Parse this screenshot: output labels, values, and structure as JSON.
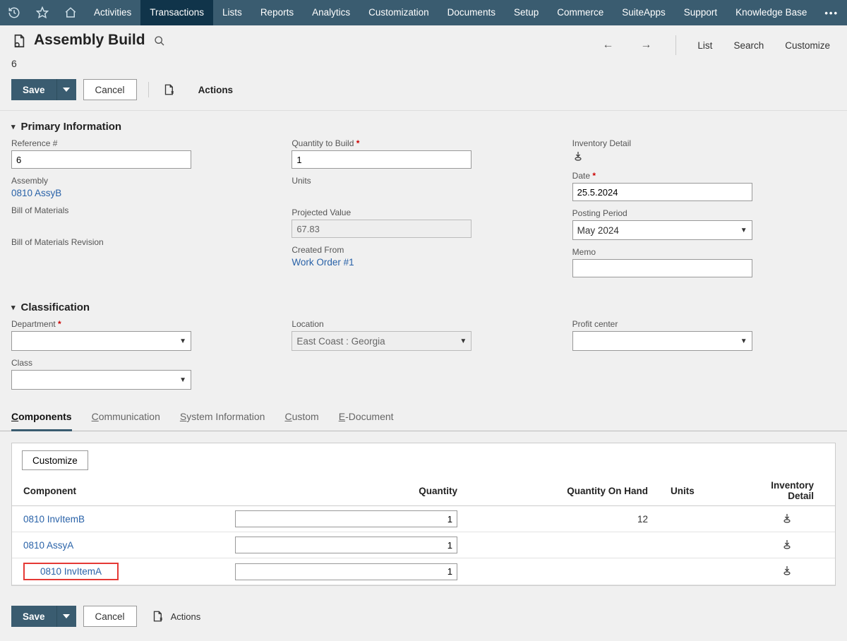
{
  "nav": {
    "items": [
      "Activities",
      "Transactions",
      "Lists",
      "Reports",
      "Analytics",
      "Customization",
      "Documents",
      "Setup",
      "Commerce",
      "SuiteApps",
      "Support",
      "Knowledge Base"
    ],
    "active_index": 1
  },
  "header": {
    "title": "Assembly Build",
    "record_sub": "6",
    "right_links": {
      "list": "List",
      "search": "Search",
      "customize": "Customize"
    }
  },
  "toolbar": {
    "save": "Save",
    "cancel": "Cancel",
    "actions": "Actions"
  },
  "sections": {
    "primary": "Primary Information",
    "classification": "Classification"
  },
  "form": {
    "reference": {
      "label": "Reference #",
      "value": "6"
    },
    "assembly": {
      "label": "Assembly",
      "value": "0810 AssyB"
    },
    "bom": {
      "label": "Bill of Materials"
    },
    "bom_rev": {
      "label": "Bill of Materials Revision"
    },
    "qty_build": {
      "label": "Quantity to Build",
      "value": "1"
    },
    "units": {
      "label": "Units"
    },
    "projected": {
      "label": "Projected Value",
      "value": "67.83"
    },
    "created_from": {
      "label": "Created From",
      "value": "Work Order #1"
    },
    "inv_detail": {
      "label": "Inventory Detail"
    },
    "date": {
      "label": "Date",
      "value": "25.5.2024"
    },
    "posting": {
      "label": "Posting Period",
      "value": "May 2024"
    },
    "memo": {
      "label": "Memo",
      "value": ""
    },
    "department": {
      "label": "Department",
      "value": ""
    },
    "class": {
      "label": "Class"
    },
    "location": {
      "label": "Location",
      "value": "East Coast : Georgia"
    },
    "profit_center": {
      "label": "Profit center",
      "value": ""
    }
  },
  "tabs": [
    "Components",
    "Communication",
    "System Information",
    "Custom",
    "E-Document"
  ],
  "active_tab_index": 0,
  "components": {
    "customize": "Customize",
    "headers": {
      "component": "Component",
      "quantity": "Quantity",
      "qoh": "Quantity On Hand",
      "units": "Units",
      "inv": "Inventory Detail"
    },
    "rows": [
      {
        "component": "0810 InvItemB",
        "quantity": "1",
        "qoh": "12",
        "highlight": false
      },
      {
        "component": "0810 AssyA",
        "quantity": "1",
        "qoh": "",
        "highlight": false
      },
      {
        "component": "0810 InvItemA",
        "quantity": "1",
        "qoh": "",
        "highlight": true
      }
    ]
  }
}
